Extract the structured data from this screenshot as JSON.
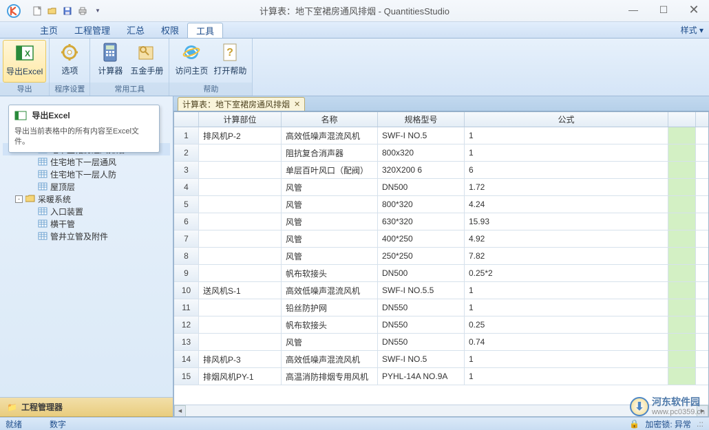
{
  "title": "计算表：地下室裙房通风排烟 - QuantitiesStudio",
  "menus": [
    "主页",
    "工程管理",
    "汇总",
    "权限",
    "工具"
  ],
  "style_label": "样式",
  "ribbon": {
    "groups": [
      {
        "label": "导出",
        "buttons": [
          {
            "label": "导出Excel",
            "icon": "excel"
          }
        ]
      },
      {
        "label": "程序设置",
        "buttons": [
          {
            "label": "选项",
            "icon": "gear"
          }
        ]
      },
      {
        "label": "常用工具",
        "buttons": [
          {
            "label": "计算器",
            "icon": "calc"
          },
          {
            "label": "五金手册",
            "icon": "book"
          }
        ]
      },
      {
        "label": "帮助",
        "buttons": [
          {
            "label": "访问主页",
            "icon": "ie"
          },
          {
            "label": "打开帮助",
            "icon": "help"
          }
        ]
      }
    ]
  },
  "tooltip": {
    "title": "导出Excel",
    "body": "导出当前表格中的所有内容至Excel文件。"
  },
  "tree": [
    {
      "indent": 48,
      "icon": "sheet",
      "label": "地下室裙房通风排烟",
      "selected": true
    },
    {
      "indent": 48,
      "icon": "sheet",
      "label": "住宅地下一层通风"
    },
    {
      "indent": 48,
      "icon": "sheet",
      "label": "住宅地下一层人防"
    },
    {
      "indent": 48,
      "icon": "sheet",
      "label": "屋顶层"
    },
    {
      "indent": 16,
      "toggle": "-",
      "icon": "folder",
      "label": "采暖系统"
    },
    {
      "indent": 48,
      "icon": "sheet",
      "label": "入口装置"
    },
    {
      "indent": 48,
      "icon": "sheet",
      "label": "横干管"
    },
    {
      "indent": 48,
      "icon": "sheet",
      "label": "管井立管及附件"
    }
  ],
  "sidebar_footer": "工程管理器",
  "tab": {
    "label": "计算表：地下室裙房通风排烟"
  },
  "grid": {
    "headers": [
      "计算部位",
      "名称",
      "规格型号",
      "公式"
    ],
    "rows": [
      {
        "n": 1,
        "c": [
          "排风机P-2",
          "高效低噪声混流风机",
          "SWF-I NO.5",
          "1"
        ]
      },
      {
        "n": 2,
        "c": [
          "",
          "阻抗复合消声器",
          "800x320",
          "1"
        ]
      },
      {
        "n": 3,
        "c": [
          "",
          "单层百叶风口（配阀）",
          "320X200 6",
          "6"
        ]
      },
      {
        "n": 4,
        "c": [
          "",
          "风管",
          "DN500",
          "1.72"
        ]
      },
      {
        "n": 5,
        "c": [
          "",
          "风管",
          "800*320",
          "4.24"
        ]
      },
      {
        "n": 6,
        "c": [
          "",
          "风管",
          "630*320",
          "15.93"
        ]
      },
      {
        "n": 7,
        "c": [
          "",
          "风管",
          "400*250",
          "4.92"
        ]
      },
      {
        "n": 8,
        "c": [
          "",
          "风管",
          "250*250",
          "7.82"
        ]
      },
      {
        "n": 9,
        "c": [
          "",
          "帆布软接头",
          "DN500",
          "0.25*2"
        ]
      },
      {
        "n": 10,
        "c": [
          "送风机S-1",
          "高效低噪声混流风机",
          "SWF-I NO.5.5",
          "1"
        ]
      },
      {
        "n": 11,
        "c": [
          "",
          "铅丝防护网",
          "DN550",
          "1"
        ]
      },
      {
        "n": 12,
        "c": [
          "",
          "帆布软接头",
          "DN550",
          "0.25"
        ]
      },
      {
        "n": 13,
        "c": [
          "",
          "风管",
          "DN550",
          "0.74"
        ]
      },
      {
        "n": 14,
        "c": [
          "排风机P-3",
          "高效低噪声混流风机",
          "SWF-I NO.5",
          "1"
        ]
      },
      {
        "n": 15,
        "c": [
          "排烟风机PY-1",
          "高温消防排烟专用风机",
          "PYHL-14A NO.9A",
          "1"
        ]
      }
    ]
  },
  "status": {
    "left1": "就绪",
    "left2": "数字",
    "right": "加密锁: 异常"
  },
  "watermark": {
    "name": "河东软件园",
    "url": "www.pc0359.cn"
  }
}
